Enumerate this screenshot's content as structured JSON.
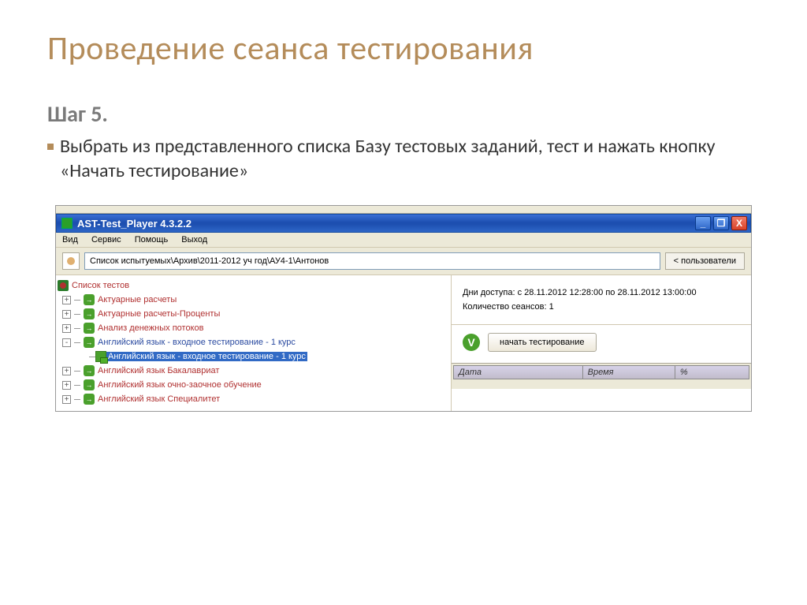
{
  "slide": {
    "title": "Проведение сеанса тестирования",
    "step_label": "Шаг 5.",
    "step_text": "Выбрать из представленного списка Базу тестовых заданий, тест и нажать кнопку «Начать тестирование»"
  },
  "app": {
    "title": "AST-Test_Player  4.3.2.2",
    "menu": {
      "view": "Вид",
      "service": "Сервис",
      "help": "Помощь",
      "exit": "Выход"
    },
    "users_btn": "< пользователи",
    "path": "Список испытуемых\\Архив\\2011-2012 уч год\\АУ4-1\\Антонов"
  },
  "tree": {
    "root": "Список тестов",
    "items": [
      {
        "label": "Актуарные расчеты",
        "exp": "+"
      },
      {
        "label": "Актуарные расчеты-Проценты",
        "exp": "+"
      },
      {
        "label": "Анализ денежных потоков",
        "exp": "+"
      },
      {
        "label": "Английский язык - входное тестирование - 1 курс",
        "exp": "-",
        "blue": true
      },
      {
        "label": "Английский язык - входное тестирование - 1 курс",
        "exp": "",
        "leaf": true,
        "selected": true
      },
      {
        "label": "Английский язык Бакалавриат",
        "exp": "+"
      },
      {
        "label": "Английский язык очно-заочное обучение",
        "exp": "+"
      },
      {
        "label": "Английский язык Специалитет",
        "exp": "+"
      }
    ]
  },
  "info": {
    "access": "Дни доступа:  с 28.11.2012 12:28:00 по 28.11.2012 13:00:00",
    "sessions": "Количество сеансов: 1",
    "start_btn": "начать тестирование"
  },
  "table": {
    "h1": "Дата",
    "h2": "Время",
    "h3": "%"
  }
}
